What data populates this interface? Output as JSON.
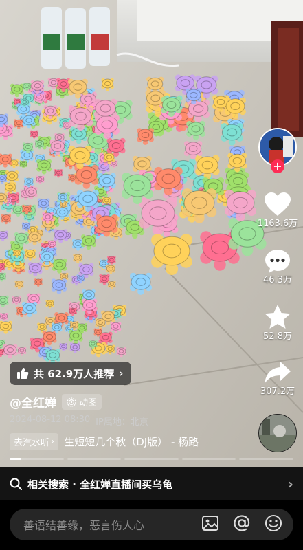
{
  "author": {
    "name": "@全红婵",
    "badge_label": "动图",
    "badge_icon": "live-photo-icon"
  },
  "meta": {
    "datetime": "2024-08-12 08:30",
    "location": "IP属地：北京"
  },
  "music": {
    "chip_label": "去汽水听",
    "title": "生短短几个秋（DJ版） - 杨路"
  },
  "recommend": {
    "label": "共 62.9万人推荐"
  },
  "actions": {
    "likes": "1163.6万",
    "comments": "46.3万",
    "favorites": "52.8万",
    "shares": "307.2万"
  },
  "progress": {
    "segments_total": 5,
    "active_segment_fraction": 0.2
  },
  "related_search": {
    "label": "相关搜索 · 全红婵直播间买乌龟"
  },
  "comment_bar": {
    "placeholder": "善语结善缘，恶言伤人心"
  },
  "colors": {
    "accent": "#fe2c55",
    "pill_bg": "#282828",
    "input_bg": "#262626"
  }
}
